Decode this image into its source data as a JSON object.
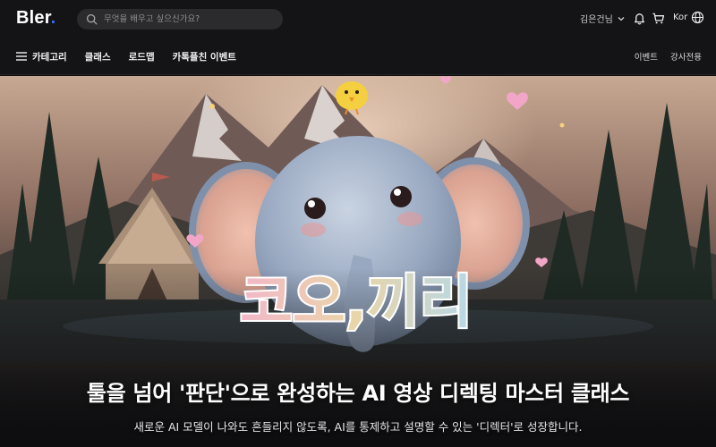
{
  "header": {
    "logo_text": "Bler",
    "logo_dot": ".",
    "search": {
      "placeholder": "무엇을 배우고 싶으신가요?"
    },
    "user_name": "김은건님",
    "language": "Kor",
    "icons": [
      "search-icon",
      "chevron-down-icon",
      "bell-icon",
      "cart-icon",
      "globe-icon"
    ]
  },
  "nav": {
    "items": [
      {
        "label": "카테고리",
        "icon": "menu-icon"
      },
      {
        "label": "클래스"
      },
      {
        "label": "로드맵"
      },
      {
        "label": "카톡플친 이벤트"
      }
    ],
    "right_items": [
      {
        "label": "이벤트"
      },
      {
        "label": "강사전용"
      }
    ]
  },
  "hero": {
    "artwork_text": "코오,끼리",
    "title": "툴을 넘어 '판단'으로 완성하는 AI 영상 디렉팅 마스터 클래스",
    "subtitle": "새로운 AI 모델이 나와도 흔들리지 않도록, AI를 통제하고 설명할 수 있는 '디렉터'로 성장합니다."
  },
  "colors": {
    "accent": "#2f6df5",
    "header_bg": "#141416",
    "page_bg": "#0d0d0f"
  }
}
